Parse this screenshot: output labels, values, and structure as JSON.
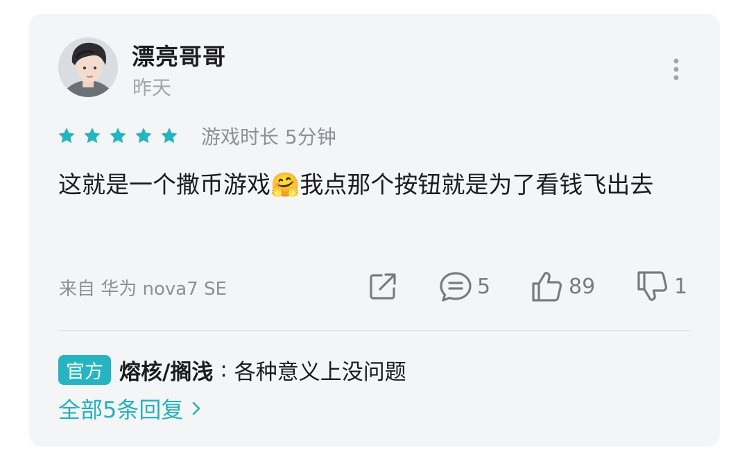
{
  "review": {
    "username": "漂亮哥哥",
    "timestamp": "昨天",
    "rating": 5,
    "playtime": "游戏时长 5分钟",
    "content": "这就是一个撒币游戏🤗我点那个按钮就是为了看钱飞出去",
    "source": "来自 华为 nova7 SE"
  },
  "actions": {
    "comments": "5",
    "likes": "89",
    "dislikes": "1"
  },
  "reply": {
    "badge": "官方",
    "author": "熔核/搁浅",
    "separator": ":",
    "text": "各种意义上没问题",
    "all_replies": "全部5条回复"
  },
  "colors": {
    "accent": "#25b5c2",
    "card_bg": "#f4f5f7",
    "muted": "#8c9096"
  },
  "icons": [
    "avatar",
    "more-icon",
    "star-icon",
    "share-icon",
    "comment-icon",
    "thumb-up-icon",
    "thumb-down-icon",
    "chevron-right-icon"
  ]
}
